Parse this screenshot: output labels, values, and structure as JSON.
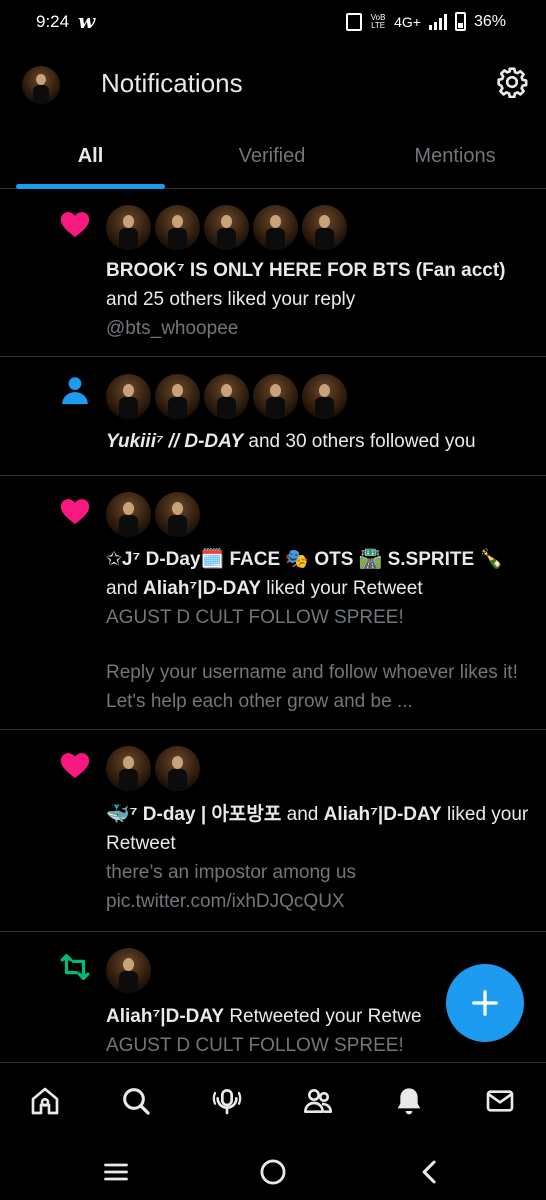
{
  "status_bar": {
    "time": "9:24",
    "app_glyph": "w",
    "lte_line1": "VoB",
    "lte_line2": "LTE",
    "network": "4G+",
    "battery": "36%",
    "battery_level": 0.36
  },
  "header": {
    "title": "Notifications",
    "avatar_icon": "profile-avatar",
    "settings_icon": "gear-icon"
  },
  "tabs": [
    {
      "label": "All",
      "active": true
    },
    {
      "label": "Verified",
      "active": false
    },
    {
      "label": "Mentions",
      "active": false
    }
  ],
  "notifications": [
    {
      "type": "like",
      "icon": "heart-icon",
      "avatar_count": 5,
      "actor": "BROOK⁷ IS ONLY HERE FOR BTS (Fan acct)",
      "action": "and 25 others liked your reply",
      "detail": "@bts_whoopee"
    },
    {
      "type": "follow",
      "icon": "person-icon",
      "avatar_count": 5,
      "actor": "Yukiii⁷ // D-DAY",
      "action": "and 30 others followed you"
    },
    {
      "type": "like",
      "icon": "heart-icon",
      "avatar_count": 2,
      "actor": "✩J⁷ D-Day🗓️ FACE 🎭 OTS 🛣️ S.SPRITE 🍾",
      "connector": "and",
      "actor2": "Aliah⁷|D-DAY",
      "action": "liked your Retweet",
      "detail_line1": "AGUST D CULT FOLLOW SPREE!",
      "detail_line2": "Reply your username and follow whoever likes it! Let's help each other grow and be ..."
    },
    {
      "type": "like",
      "icon": "heart-icon",
      "avatar_count": 2,
      "actor": "🐳⁷ D-day | 아포방포",
      "connector": "and",
      "actor2": "Aliah⁷|D-DAY",
      "action": "liked your Retweet",
      "detail_line1": "there’s an impostor among us",
      "detail_line2": "pic.twitter.com/ixhDJQcQUX"
    },
    {
      "type": "retweet",
      "icon": "retweet-icon",
      "avatar_count": 1,
      "actor": "Aliah⁷|D-DAY",
      "action": "Retweeted your Retwe",
      "detail_line1": "AGUST D CULT FOLLOW SPREE!"
    }
  ],
  "fab": {
    "label": "+"
  },
  "bottom_nav": [
    "home-icon",
    "search-icon",
    "spaces-icon",
    "communities-icon",
    "notifications-bell-icon",
    "messages-icon"
  ],
  "system_nav": [
    "recents-icon",
    "home-circle-icon",
    "back-icon"
  ],
  "colors": {
    "background": "#000000",
    "accent": "#1d9bf0",
    "like": "#f91880",
    "retweet": "#00ba7c",
    "muted_text": "#71767b",
    "divider": "#2f3336"
  }
}
